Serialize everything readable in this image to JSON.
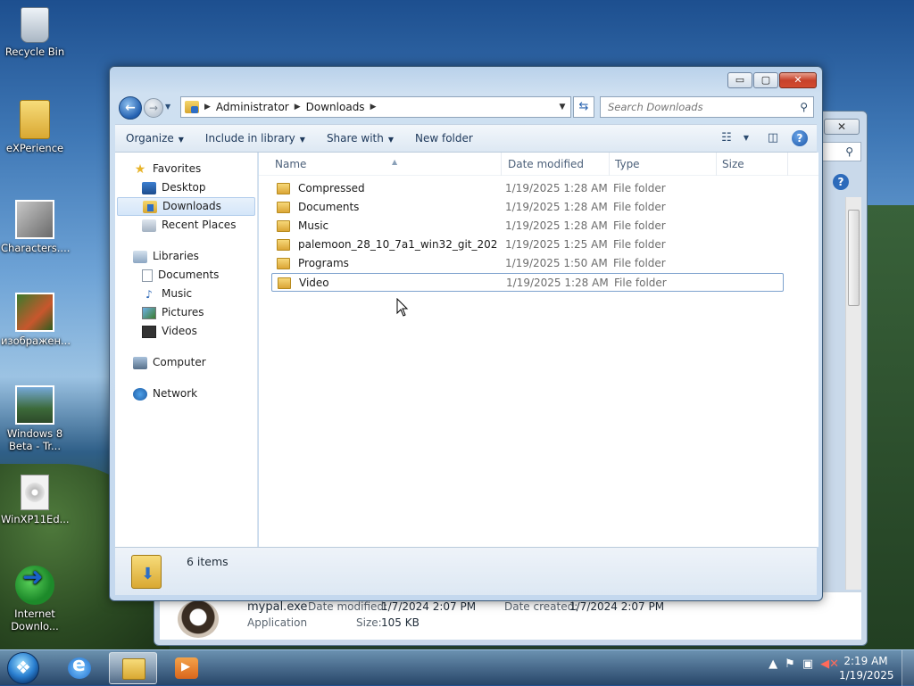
{
  "desktop": {
    "icons": [
      {
        "label": "Recycle Bin",
        "icon": "recycle-bin-icon"
      },
      {
        "label": "eXPerience",
        "icon": "folder-icon"
      },
      {
        "label": "Characters....",
        "icon": "image-icon"
      },
      {
        "label": "изображен...",
        "icon": "image-icon"
      },
      {
        "label": "Windows 8 Beta - Tr...",
        "icon": "image-icon"
      },
      {
        "label": "WinXP11Ed...",
        "icon": "disc-image-icon"
      },
      {
        "label": "Internet Downlo...",
        "icon": "idm-icon"
      }
    ]
  },
  "background_window": {
    "details": {
      "name": "mypal.exe",
      "type": "Application",
      "date_modified_label": "Date modified:",
      "date_modified": "1/7/2024 2:07 PM",
      "date_created_label": "Date created:",
      "date_created": "1/7/2024 2:07 PM",
      "size_label": "Size:",
      "size": "105 KB"
    }
  },
  "window": {
    "caption": {
      "minimize": "▭",
      "maximize": "▢",
      "close": "✕"
    },
    "breadcrumb": [
      "Administrator",
      "Downloads"
    ],
    "search_placeholder": "Search Downloads",
    "toolbar": {
      "organize": "Organize",
      "include_in_library": "Include in library",
      "share_with": "Share with",
      "new_folder": "New folder"
    },
    "nav": {
      "favorites": "Favorites",
      "desktop": "Desktop",
      "downloads": "Downloads",
      "recent_places": "Recent Places",
      "libraries": "Libraries",
      "documents": "Documents",
      "music": "Music",
      "pictures": "Pictures",
      "videos": "Videos",
      "computer": "Computer",
      "network": "Network"
    },
    "columns": {
      "name": "Name",
      "date_modified": "Date modified",
      "type": "Type",
      "size": "Size"
    },
    "files": [
      {
        "name": "Compressed",
        "date": "1/19/2025 1:28 AM",
        "type": "File folder"
      },
      {
        "name": "Documents",
        "date": "1/19/2025 1:28 AM",
        "type": "File folder"
      },
      {
        "name": "Music",
        "date": "1/19/2025 1:28 AM",
        "type": "File folder"
      },
      {
        "name": "palemoon_28_10_7a1_win32_git_202",
        "date": "1/19/2025 1:25 AM",
        "type": "File folder"
      },
      {
        "name": "Programs",
        "date": "1/19/2025 1:50 AM",
        "type": "File folder"
      },
      {
        "name": "Video",
        "date": "1/19/2025 1:28 AM",
        "type": "File folder"
      }
    ],
    "status": "6 items"
  },
  "taskbar": {
    "time": "2:19 AM",
    "date": "1/19/2025"
  }
}
